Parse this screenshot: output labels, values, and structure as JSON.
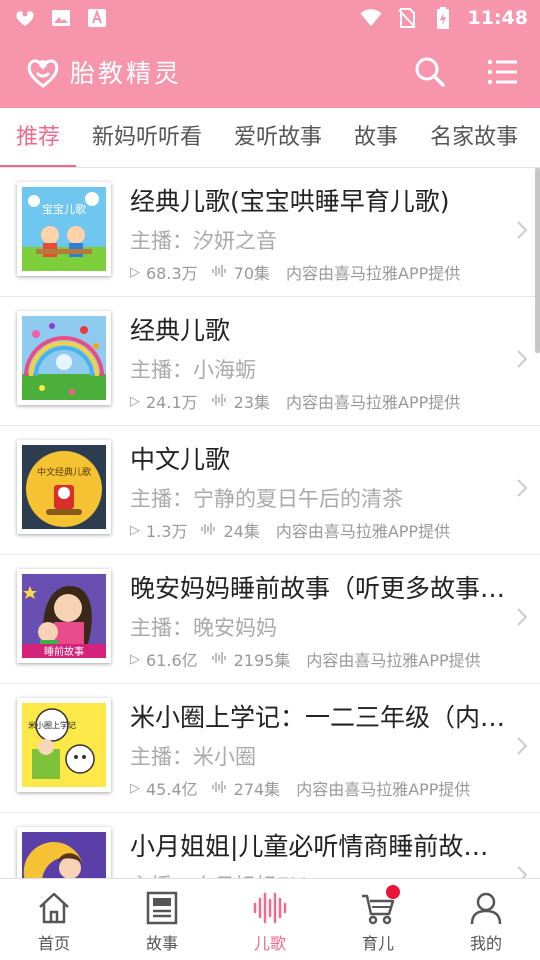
{
  "status_bar": {
    "time": "11:48",
    "left_icons": [
      "app-logo-icon",
      "image-icon",
      "app-a-icon"
    ],
    "right_icons": [
      "wifi-icon",
      "no-sim-icon",
      "battery-charging-icon"
    ]
  },
  "app_bar": {
    "title": "胎教精灵",
    "icons": [
      "search-icon",
      "menu-list-icon"
    ]
  },
  "colors": {
    "primary": "#f795ac",
    "accent": "#f06a8d",
    "badge": "#e8143a"
  },
  "tabs": [
    {
      "label": "推荐",
      "active": true
    },
    {
      "label": "新妈听听看",
      "active": false
    },
    {
      "label": "爱听故事",
      "active": false
    },
    {
      "label": "故事",
      "active": false
    },
    {
      "label": "名家故事",
      "active": false
    }
  ],
  "list": [
    {
      "title": "经典儿歌(宝宝哄睡早育儿歌)",
      "host": "主播：汐妍之音",
      "plays": "68.3万",
      "episodes": "70集",
      "provider": "内容由喜马拉雅APP提供",
      "thumb_text": "宝宝儿歌"
    },
    {
      "title": "经典儿歌",
      "host": "主播：小海蛎",
      "plays": "24.1万",
      "episodes": "23集",
      "provider": "内容由喜马拉雅APP提供",
      "thumb_text": ""
    },
    {
      "title": "中文儿歌",
      "host": "主播：宁静的夏日午后的清茶",
      "plays": "1.3万",
      "episodes": "24集",
      "provider": "内容由喜马拉雅APP提供",
      "thumb_text": "中文经典儿歌"
    },
    {
      "title": "晚安妈妈睡前故事（听更多故事…",
      "host": "主播：晚安妈妈",
      "plays": "61.6亿",
      "episodes": "2195集",
      "provider": "内容由喜马拉雅APP提供",
      "thumb_text": "睡前故事"
    },
    {
      "title": "米小圈上学记：一二三年级（内…",
      "host": "主播：米小圈",
      "plays": "45.4亿",
      "episodes": "274集",
      "provider": "内容由喜马拉雅APP提供",
      "thumb_text": "米小圈上学记"
    },
    {
      "title": "小月姐姐|儿童必听情商睡前故…",
      "host": "主播：小月姐姐FM",
      "plays": "",
      "episodes": "",
      "provider": "",
      "thumb_text": ""
    }
  ],
  "bottom_nav": [
    {
      "label": "首页",
      "icon": "home-icon",
      "active": false
    },
    {
      "label": "故事",
      "icon": "newspaper-icon",
      "active": false
    },
    {
      "label": "儿歌",
      "icon": "sound-wave-icon",
      "active": true
    },
    {
      "label": "育儿",
      "icon": "stroller-icon",
      "active": false,
      "badge": true
    },
    {
      "label": "我的",
      "icon": "profile-icon",
      "active": false
    }
  ]
}
